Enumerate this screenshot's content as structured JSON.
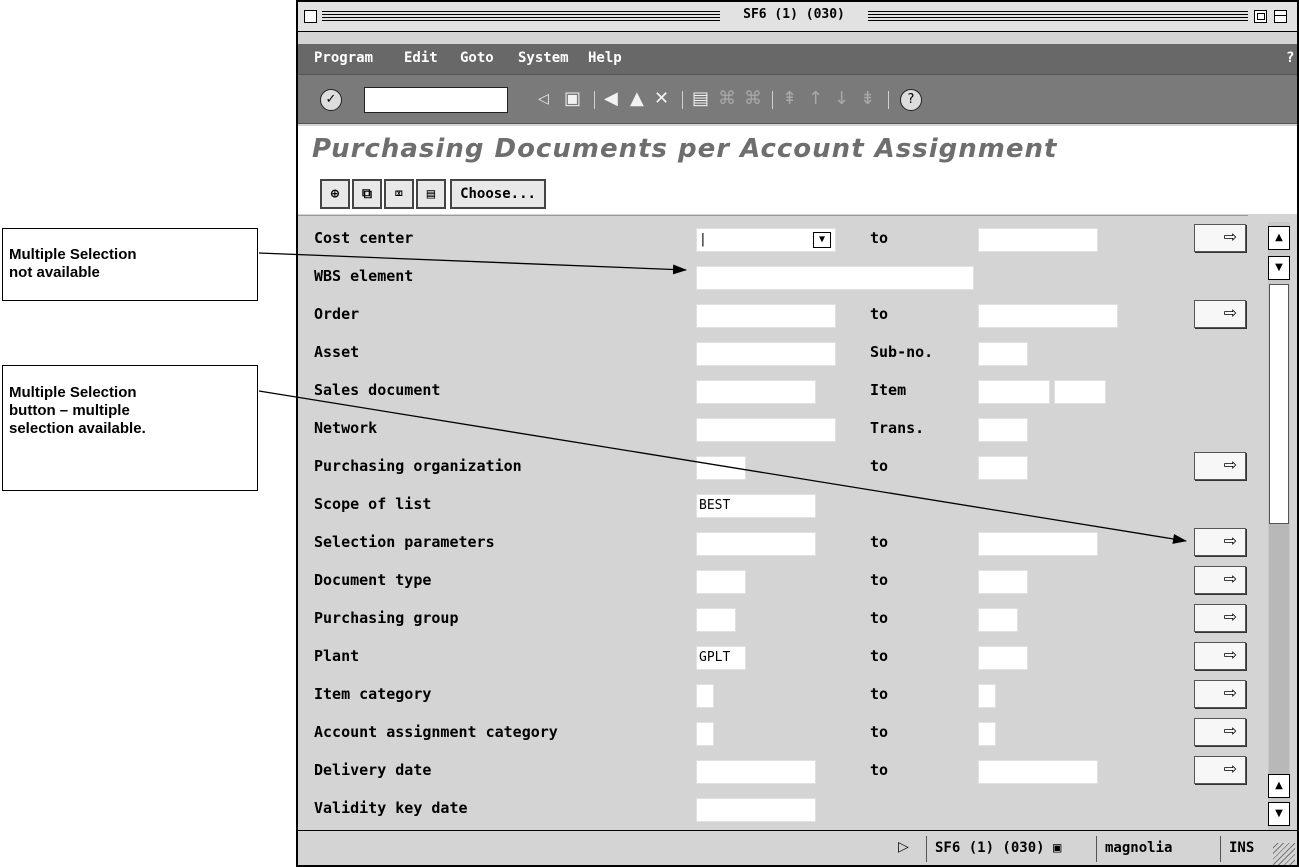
{
  "callouts": {
    "single": [
      "Multiple Selection",
      "not available"
    ],
    "multiple": [
      "Multiple Selection",
      "button – multiple",
      "selection available."
    ]
  },
  "window": {
    "title": "SF6 (1) (030)"
  },
  "menu": [
    "Program",
    "Edit",
    "Goto",
    "System",
    "Help",
    "?"
  ],
  "toolbar": {
    "command_value": "",
    "icons": [
      "enter-icon",
      "back-arrow-icon",
      "save-icon",
      "back-icon",
      "exit-icon",
      "cancel-icon",
      "print-icon",
      "find-icon",
      "find-next-icon",
      "first-page-icon",
      "previous-page-icon",
      "next-page-icon",
      "last-page-icon",
      "help-icon"
    ]
  },
  "page": {
    "title": "Purchasing Documents per Account Assignment"
  },
  "app_toolbar": {
    "choose_label": "Choose...",
    "icons": [
      "execute-icon",
      "copy-icon",
      "delete-icon",
      "save-variant-icon"
    ]
  },
  "form": {
    "to_label": "to",
    "rows": [
      {
        "label": "Cost center",
        "mid": "to",
        "value": "|",
        "has_dropdown": true,
        "has_ms": true
      },
      {
        "label": "WBS element",
        "mid": "",
        "value": "",
        "has_ms": false
      },
      {
        "label": "Order",
        "mid": "to",
        "value": "",
        "has_ms": true
      },
      {
        "label": "Asset",
        "mid": "Sub-no.",
        "value": "",
        "has_ms": false
      },
      {
        "label": "Sales document",
        "mid": "Item",
        "value": "",
        "has_ms": false
      },
      {
        "label": "Network",
        "mid": "Trans.",
        "value": "",
        "has_ms": false
      },
      {
        "label": "Purchasing organization",
        "mid": "to",
        "value": "",
        "has_ms": true
      },
      {
        "label": "Scope of list",
        "mid": "",
        "value": "BEST",
        "has_ms": false
      },
      {
        "label": "Selection parameters",
        "mid": "to",
        "value": "",
        "has_ms": true
      },
      {
        "label": "Document type",
        "mid": "to",
        "value": "",
        "has_ms": true
      },
      {
        "label": "Purchasing group",
        "mid": "to",
        "value": "",
        "has_ms": true
      },
      {
        "label": "Plant",
        "mid": "to",
        "value": "GPLT",
        "has_ms": true
      },
      {
        "label": "Item category",
        "mid": "to",
        "value": "",
        "has_ms": true
      },
      {
        "label": "Account assignment category",
        "mid": "to",
        "value": "",
        "has_ms": true
      },
      {
        "label": "Delivery date",
        "mid": "to",
        "value": "",
        "has_ms": true
      },
      {
        "label": "Validity key date",
        "mid": "",
        "value": "",
        "has_ms": false
      }
    ]
  },
  "status": {
    "system": "SF6 (1) (030)",
    "server": "magnolia",
    "mode": "INS"
  },
  "colors": {
    "menubar": "#686868",
    "toolbar": "#7a7a7a",
    "form_bg": "#d4d4d4",
    "title_text": "#6e6e6e"
  }
}
